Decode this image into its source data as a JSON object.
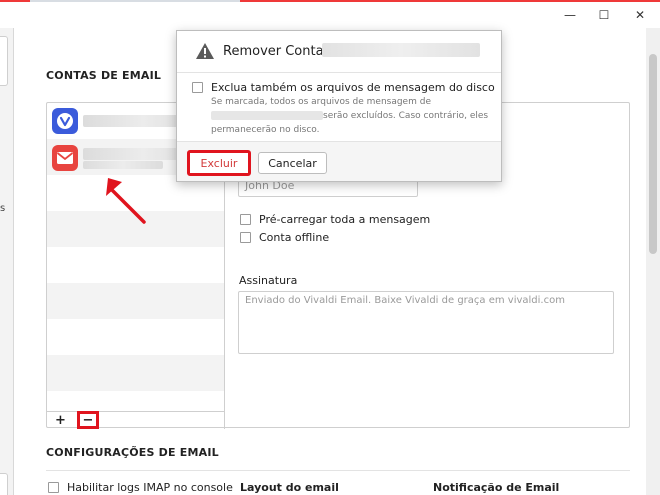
{
  "window": {
    "minimize_glyph": "—",
    "maximize_glyph": "☐",
    "close_glyph": "✕",
    "left_edge_char": "s"
  },
  "sections": {
    "email_accounts": "CONTAS DE EMAIL",
    "email_settings": "CONFIGURAÇÕES DE EMAIL"
  },
  "accounts_panel": {
    "add_glyph": "+",
    "remove_glyph": "−",
    "name_placeholder": "John Doe",
    "preload_label": "Pré-carregar toda a mensagem",
    "offline_label": "Conta offline",
    "signature_label": "Assinatura",
    "signature_placeholder": "Enviado do Vivaldi Email. Baixe Vivaldi de graça em vivaldi.com"
  },
  "settings": {
    "imap_label": "Habilitar logs IMAP no console",
    "layout_label": "Layout do email",
    "notification_label": "Notificação de Email"
  },
  "dialog": {
    "title": "Remover Conta",
    "delete_files_label": "Exclua também os arquivos de mensagem do disco",
    "desc_line1": "Se marcada, todos os arquivos de mensagem de",
    "desc_line2_suffix": "serão excluídos. Caso contrário, eles",
    "desc_line3": "permanecerão no disco.",
    "delete_button": "Excluir",
    "cancel_button": "Cancelar"
  },
  "colors": {
    "accent_red": "#e0141e",
    "vivaldi_blue": "#3b5bdb",
    "mail_red": "#e8443f"
  }
}
